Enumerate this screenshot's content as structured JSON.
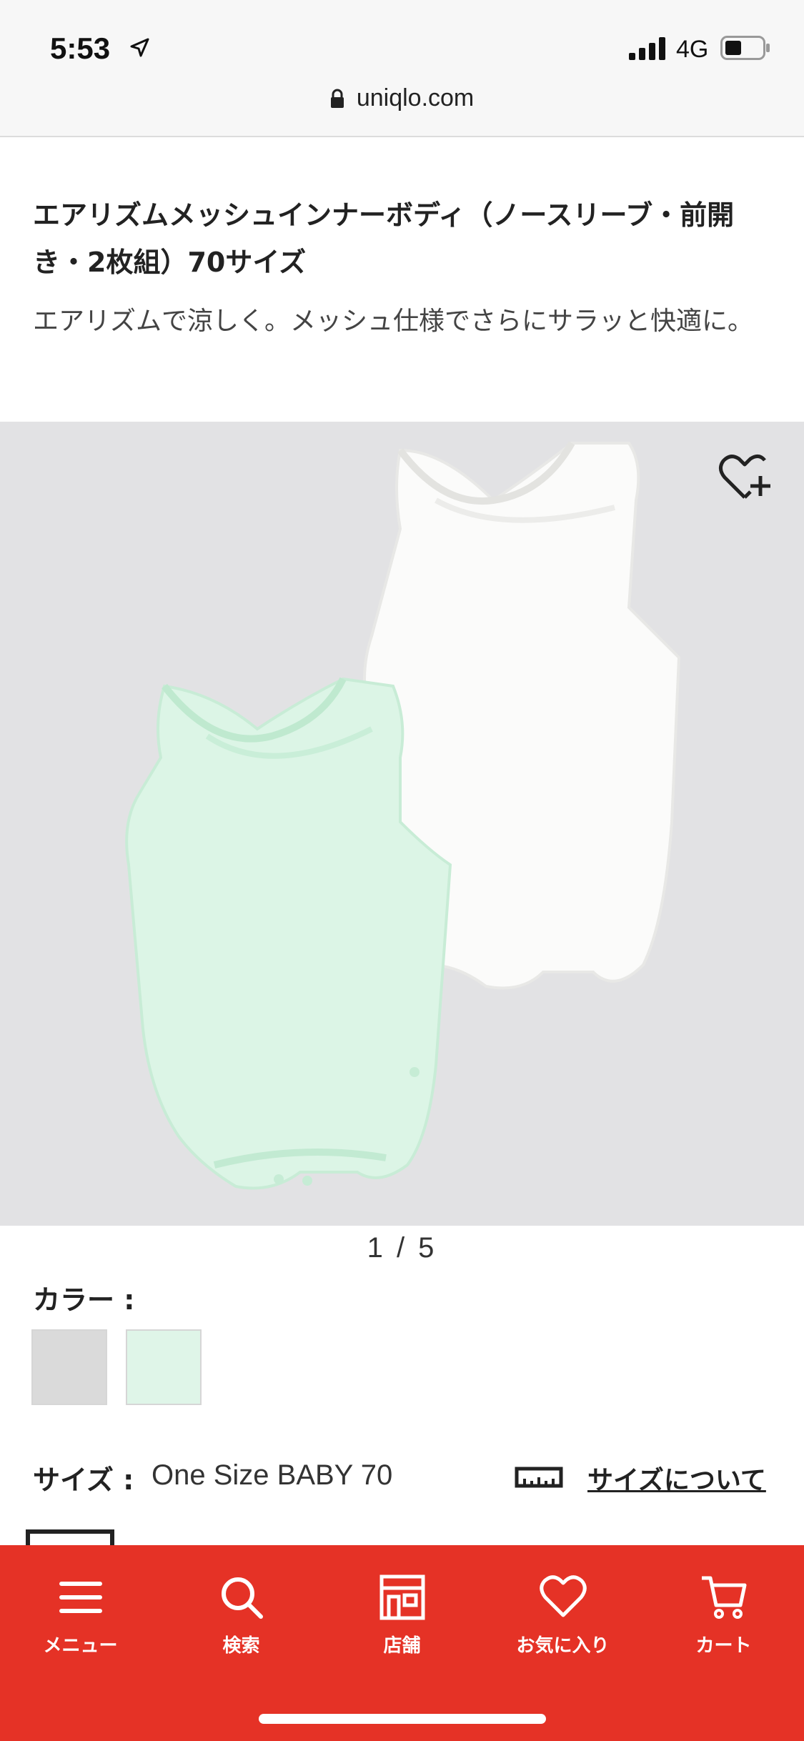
{
  "status_bar": {
    "time": "5:53",
    "network": "4G",
    "icons": [
      "location-arrow-icon",
      "signal-bars-icon",
      "battery-icon"
    ]
  },
  "browser": {
    "url": "uniqlo.com",
    "icon": "lock-icon"
  },
  "product": {
    "title": "エアリズムメッシュインナーボディ（ノースリーブ・前開き・2枚組）70サイズ",
    "description": "エアリズムで涼しく。メッシュ仕様でさらにサラッと快適に。",
    "image_pager": "1 / 5",
    "favorite_icon": "heart-plus-icon"
  },
  "options": {
    "color_label": "カラー :",
    "color_swatches": [
      {
        "name": "gray",
        "color": "#dadada"
      },
      {
        "name": "mint",
        "color": "#dff5e8"
      }
    ],
    "size_label": "サイズ :",
    "size_value": "One Size BABY 70",
    "size_guide_link": "サイズについて",
    "size_guide_icon": "ruler-icon"
  },
  "bottom_nav": {
    "background": "#e53226",
    "items": [
      {
        "label": "メニュー",
        "icon": "menu-icon"
      },
      {
        "label": "検索",
        "icon": "search-icon"
      },
      {
        "label": "店舗",
        "icon": "store-icon"
      },
      {
        "label": "お気に入り",
        "icon": "heart-icon"
      },
      {
        "label": "カート",
        "icon": "cart-icon"
      }
    ]
  }
}
